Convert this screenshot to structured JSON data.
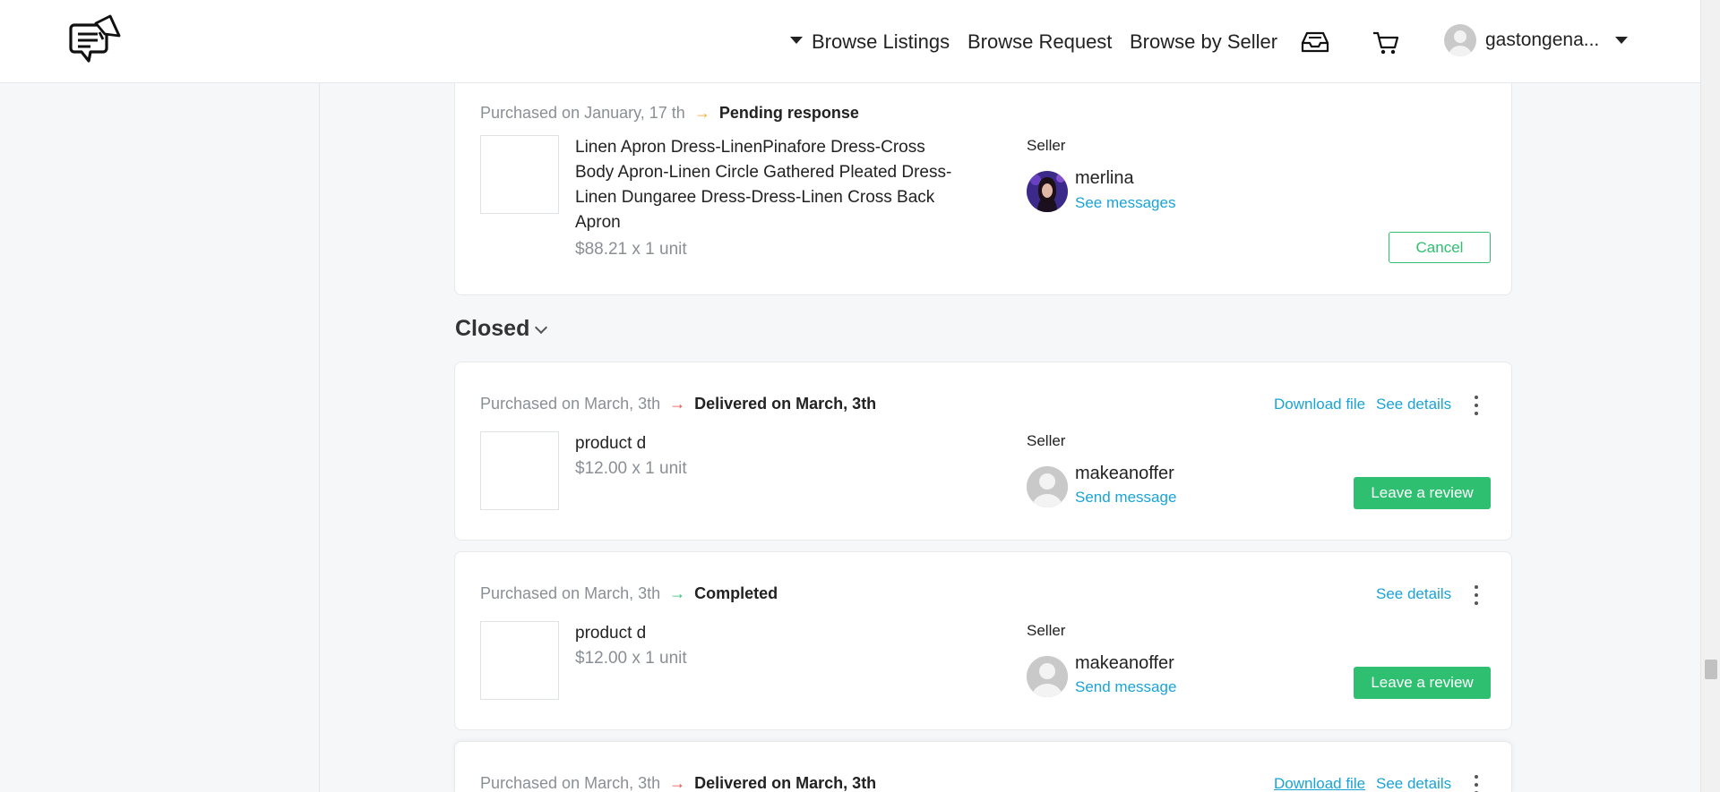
{
  "header": {
    "nav": {
      "browse_listings": "Browse Listings",
      "browse_request": "Browse Request",
      "browse_by_seller": "Browse by Seller"
    },
    "icons": [
      "inbox-icon",
      "cart-icon"
    ],
    "user": {
      "name": "gastongena..."
    }
  },
  "pending_order": {
    "purchased": "Purchased on January, 17 th",
    "status": "Pending response",
    "status_color": "#f5a623",
    "product_name_lines": [
      "Linen Apron Dress-LinenPinafore Dress-Cross",
      "Body Apron-Linen Circle Gathered Pleated Dress-",
      "Linen Dungaree Dress-Dress-Linen Cross Back",
      "Apron"
    ],
    "price": "$88.21 x 1 unit",
    "seller_label": "Seller",
    "seller_name": "merlina",
    "seller_link": "See messages",
    "cancel_label": "Cancel"
  },
  "closed_section": {
    "title": "Closed"
  },
  "closed_orders": [
    {
      "purchased": "Purchased on March, 3th",
      "status": "Delivered on March, 3th",
      "arrow_color": "#e74c3c",
      "download": "Download file",
      "details": "See details",
      "product_name": "product d",
      "price": "$12.00 x 1 unit",
      "seller_label": "Seller",
      "seller_name": "makeanoffer",
      "seller_link": "Send message",
      "review_label": "Leave a review"
    },
    {
      "purchased": "Purchased on March, 3th",
      "status": "Completed",
      "arrow_color": "#2fbf71",
      "details": "See details",
      "product_name": "product d",
      "price": "$12.00 x 1 unit",
      "seller_label": "Seller",
      "seller_name": "makeanoffer",
      "seller_link": "Send message",
      "review_label": "Leave a review"
    },
    {
      "purchased": "Purchased on March, 3th",
      "status": "Delivered on March, 3th",
      "arrow_color": "#e74c3c",
      "download": "Download file",
      "details": "See details"
    }
  ],
  "colors": {
    "accent_link": "#1aa3d6",
    "accent_green": "#2fbf71"
  }
}
